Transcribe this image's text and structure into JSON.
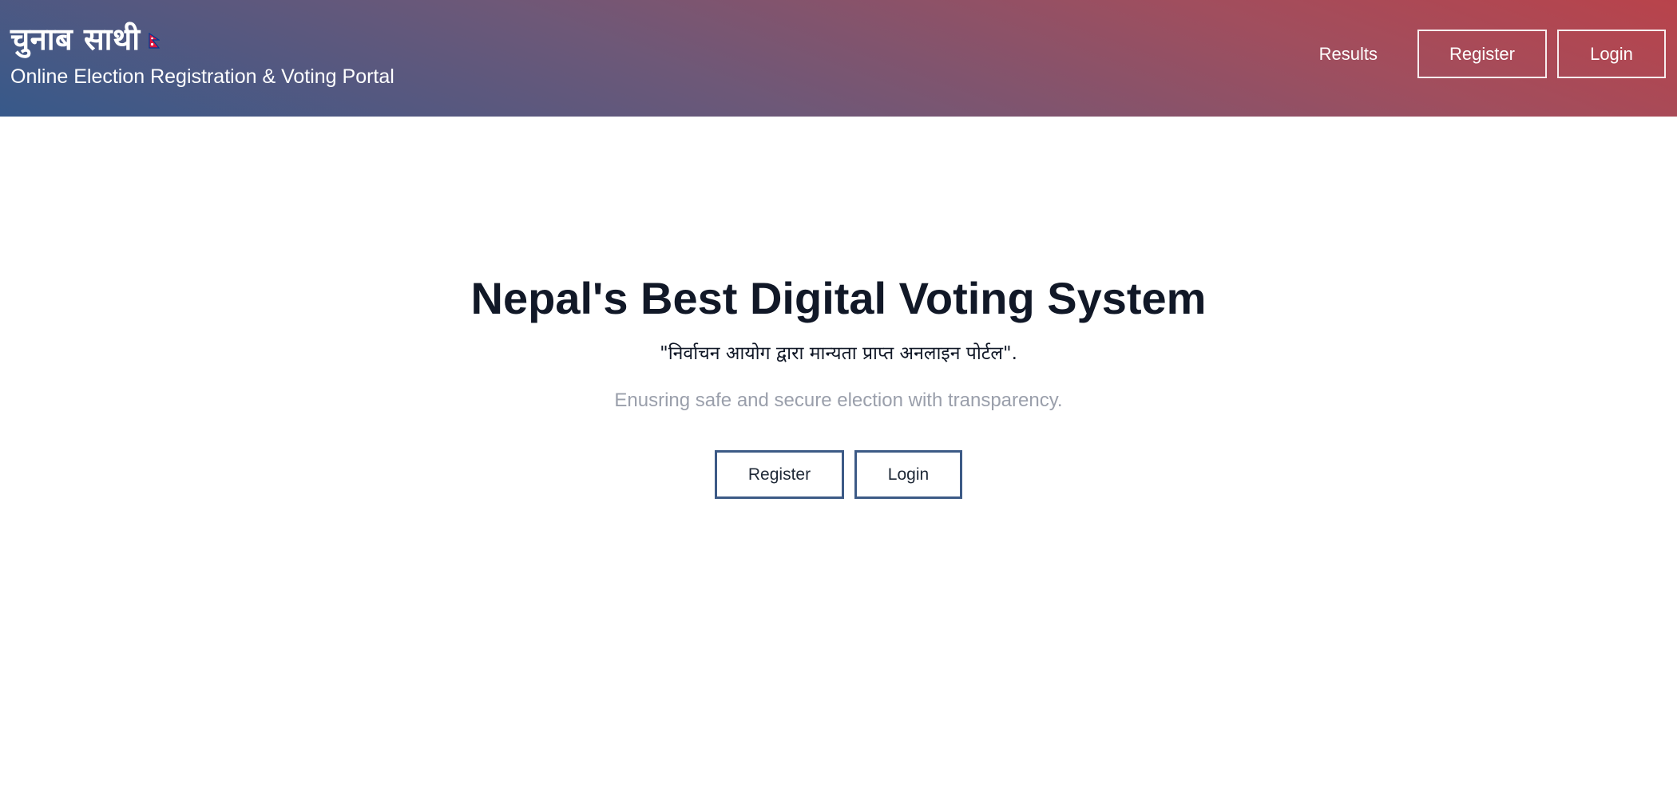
{
  "header": {
    "brand_title": "चुनाब साथी",
    "brand_subtitle": "Online Election Registration & Voting Portal",
    "nav": {
      "results_label": "Results",
      "register_label": "Register",
      "login_label": "Login"
    }
  },
  "hero": {
    "title": "Nepal's Best Digital Voting System",
    "quote": "\"निर्वाचन आयोग द्वारा मान्यता प्राप्त अनलाइन पोर्टल\".",
    "tagline": "Enusring safe and secure election with transparency.",
    "register_label": "Register",
    "login_label": "Login"
  },
  "colors": {
    "header_gradient_start": "#37598a",
    "header_gradient_end": "#b9434b",
    "button_border": "#3c5a86",
    "title_text": "#111827",
    "tagline_text": "#9a9fab"
  },
  "icons": {
    "brand_flag": "nepal-flag-icon"
  }
}
